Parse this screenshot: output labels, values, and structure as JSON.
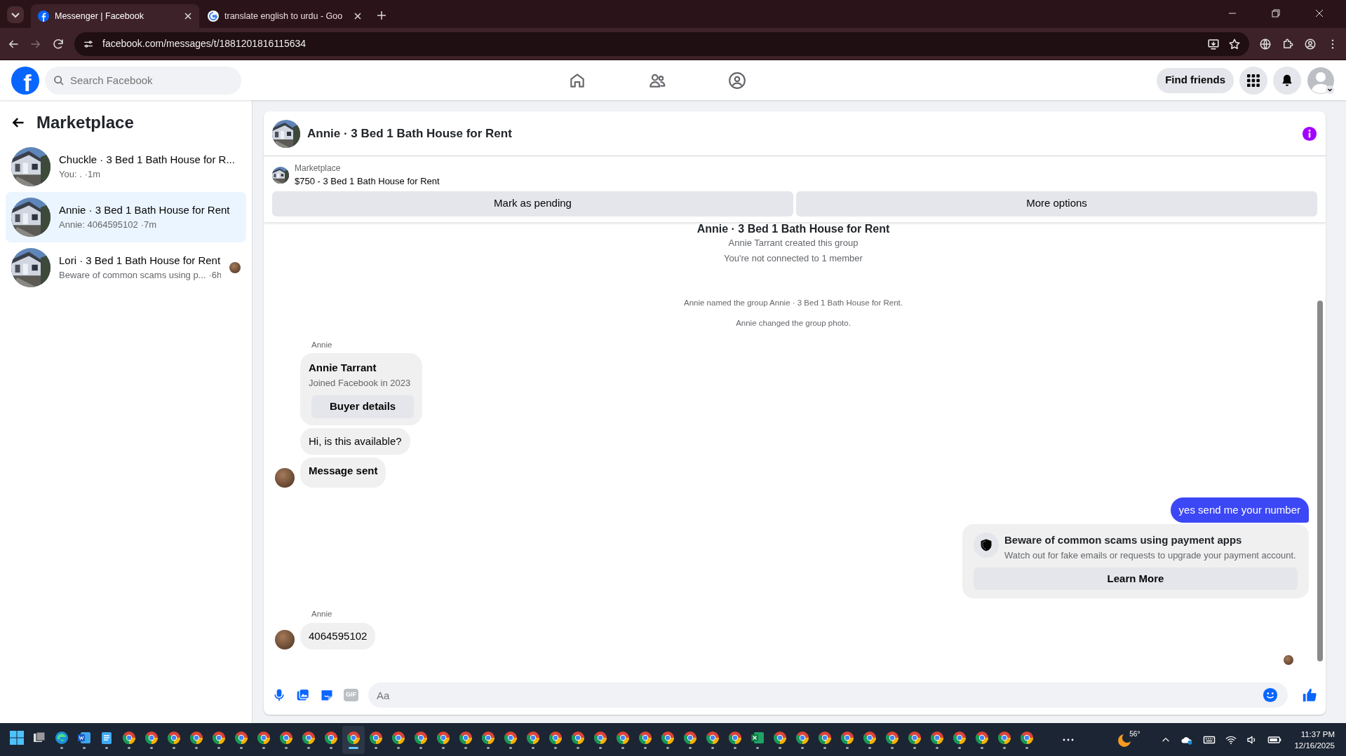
{
  "browser": {
    "tabs": [
      {
        "title": "Messenger | Facebook",
        "kind": "facebook",
        "selected": true
      },
      {
        "title": "translate english to urdu - Goo",
        "kind": "google",
        "selected": false
      }
    ],
    "address": "facebook.com/messages/t/1881201816115634"
  },
  "header": {
    "logo": "f",
    "search": {
      "placeholder": "Search Facebook"
    },
    "find_friends": "Find friends"
  },
  "sidebar": {
    "title": "Marketplace",
    "conversations": [
      {
        "title": "Chuckle · 3 Bed 1 Bath House for R...",
        "preview": "You: .",
        "time": "·1m",
        "selected": false,
        "seen": false
      },
      {
        "title": "Annie · 3 Bed 1 Bath House for Rent",
        "preview": "Annie: 4064595102",
        "time": "·7m",
        "selected": true,
        "seen": false
      },
      {
        "title": "Lori · 3 Bed 1 Bath House for Rent",
        "preview": "Beware of common scams using p...",
        "time": "·6h",
        "selected": false,
        "seen": true
      }
    ]
  },
  "chat": {
    "title": "Annie · 3 Bed 1 Bath House for Rent",
    "listing": {
      "label": "Marketplace",
      "title": "$750 - 3 Bed 1 Bath House for Rent"
    },
    "actions": [
      "Mark as pending",
      "More options"
    ],
    "messages": [
      {
        "kind": "heading",
        "text": "Annie · 3 Bed 1 Bath House for Rent"
      },
      {
        "kind": "system",
        "text": "Annie Tarrant created this group"
      },
      {
        "kind": "system",
        "text": "You're not connected to 1 member"
      },
      {
        "kind": "system_small",
        "text": "Annie named the group Annie · 3 Bed 1 Bath House for Rent."
      },
      {
        "kind": "system_small",
        "text": "Annie changed the group photo."
      },
      {
        "kind": "incoming",
        "sender": "Annie",
        "items": [
          {
            "kind": "profile",
            "name": "Annie Tarrant",
            "sub": "Joined Facebook in 2023",
            "button": "Buyer details"
          },
          {
            "kind": "text",
            "text": "Hi, is this available?",
            "bold": false
          },
          {
            "kind": "text",
            "text": "Message sent",
            "bold": true
          }
        ]
      },
      {
        "kind": "outgoing",
        "text": "yes send me your number"
      },
      {
        "kind": "notice",
        "title": "Beware of common scams using payment apps",
        "body": "Watch out for fake emails or requests to upgrade your payment account.",
        "button": "Learn More"
      },
      {
        "kind": "incoming",
        "sender": "Annie",
        "items": [
          {
            "kind": "text",
            "text": "4064595102",
            "bold": false
          }
        ]
      },
      {
        "kind": "seen"
      }
    ],
    "composer": {
      "gif": "GIF",
      "placeholder": "Aa"
    }
  },
  "taskbar": {
    "apps": [
      {
        "kind": "start",
        "selected": false
      },
      {
        "kind": "taskview",
        "selected": false
      },
      {
        "kind": "edge",
        "selected": false
      },
      {
        "kind": "word",
        "selected": false
      },
      {
        "kind": "notepad",
        "selected": false
      },
      {
        "kind": "chrome",
        "selected": false
      },
      {
        "kind": "chrome",
        "selected": false
      },
      {
        "kind": "chrome",
        "selected": false
      },
      {
        "kind": "chrome",
        "selected": false
      },
      {
        "kind": "chrome",
        "selected": false
      },
      {
        "kind": "chrome",
        "selected": false
      },
      {
        "kind": "chrome",
        "selected": false
      },
      {
        "kind": "chrome",
        "selected": false
      },
      {
        "kind": "chrome",
        "selected": false
      },
      {
        "kind": "chrome",
        "selected": false
      },
      {
        "kind": "chrome",
        "selected": true
      },
      {
        "kind": "chrome",
        "selected": false
      },
      {
        "kind": "chrome",
        "selected": false
      },
      {
        "kind": "chrome",
        "selected": false
      },
      {
        "kind": "chrome",
        "selected": false
      },
      {
        "kind": "chrome",
        "selected": false
      },
      {
        "kind": "chrome",
        "selected": false
      },
      {
        "kind": "chrome",
        "selected": false
      },
      {
        "kind": "chrome",
        "selected": false
      },
      {
        "kind": "chrome",
        "selected": false
      },
      {
        "kind": "chrome",
        "selected": false
      },
      {
        "kind": "chrome",
        "selected": false
      },
      {
        "kind": "chrome",
        "selected": false
      },
      {
        "kind": "chrome",
        "selected": false
      },
      {
        "kind": "chrome",
        "selected": false
      },
      {
        "kind": "chrome",
        "selected": false
      },
      {
        "kind": "chrome",
        "selected": false
      },
      {
        "kind": "chrome",
        "selected": false
      },
      {
        "kind": "excel",
        "selected": false
      },
      {
        "kind": "chrome",
        "selected": false
      },
      {
        "kind": "chrome",
        "selected": false
      },
      {
        "kind": "chrome",
        "selected": false
      },
      {
        "kind": "chrome",
        "selected": false
      },
      {
        "kind": "chrome",
        "selected": false
      },
      {
        "kind": "chrome",
        "selected": false
      },
      {
        "kind": "chrome",
        "selected": false
      },
      {
        "kind": "chrome",
        "selected": false
      },
      {
        "kind": "chrome",
        "selected": false
      },
      {
        "kind": "chrome",
        "selected": false
      },
      {
        "kind": "chrome",
        "selected": false
      },
      {
        "kind": "chrome",
        "selected": false
      }
    ],
    "temperature": "56°",
    "time": "11:37 PM",
    "date": "12/16/2025"
  }
}
